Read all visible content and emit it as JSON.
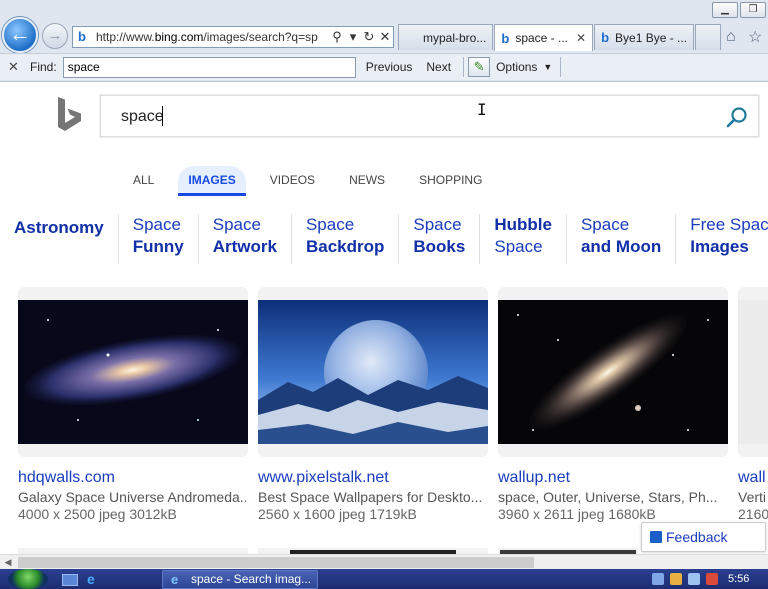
{
  "browser": {
    "address_url_prefix": "http://www.",
    "address_url_domain": "bing.com",
    "address_url_suffix": "/images/search?q=sp",
    "tabs": [
      {
        "label": "mypal-bro...",
        "active": false
      },
      {
        "label": "space - ...",
        "active": true
      },
      {
        "label": "Bye1 Bye - ...",
        "active": false
      }
    ],
    "find_bar": {
      "label": "Find:",
      "value": "space",
      "previous": "Previous",
      "next": "Next",
      "options": "Options"
    }
  },
  "search": {
    "query": "space"
  },
  "nav": [
    {
      "label": "ALL"
    },
    {
      "label": "IMAGES",
      "active": true
    },
    {
      "label": "VIDEOS"
    },
    {
      "label": "NEWS"
    },
    {
      "label": "SHOPPING"
    }
  ],
  "related": [
    {
      "line1": "Astronomy",
      "line2": ""
    },
    {
      "line1": "Space",
      "line2": "Funny"
    },
    {
      "line1": "Space",
      "line2": "Artwork"
    },
    {
      "line1": "Space",
      "line2": "Backdrop"
    },
    {
      "line1": "Space",
      "line2": "Books"
    },
    {
      "line1": "Hubble",
      "line2": "Space"
    },
    {
      "line1": "Space",
      "line2": "and Moon"
    },
    {
      "line1": "Free Space",
      "line2": "Images"
    }
  ],
  "results": [
    {
      "source": "hdqwalls.com",
      "title": "Galaxy Space Universe Andromeda...",
      "meta": "4000 x 2500 jpeg 3012kB"
    },
    {
      "source": "www.pixelstalk.net",
      "title": "Best Space Wallpapers for Deskto...",
      "meta": "2560 x 1600 jpeg 1719kB"
    },
    {
      "source": "wallup.net",
      "title": "space, Outer, Universe, Stars, Ph...",
      "meta": "3960 x 2611 jpeg 1680kB"
    },
    {
      "source": "wall",
      "title": "Verti",
      "meta": "2160"
    }
  ],
  "feedback": {
    "label": "Feedback"
  },
  "taskbar": {
    "task_label": "space - Search imag...",
    "clock": "5:56"
  },
  "colors": {
    "accent": "#174ae4",
    "link": "#1a3cbf"
  }
}
